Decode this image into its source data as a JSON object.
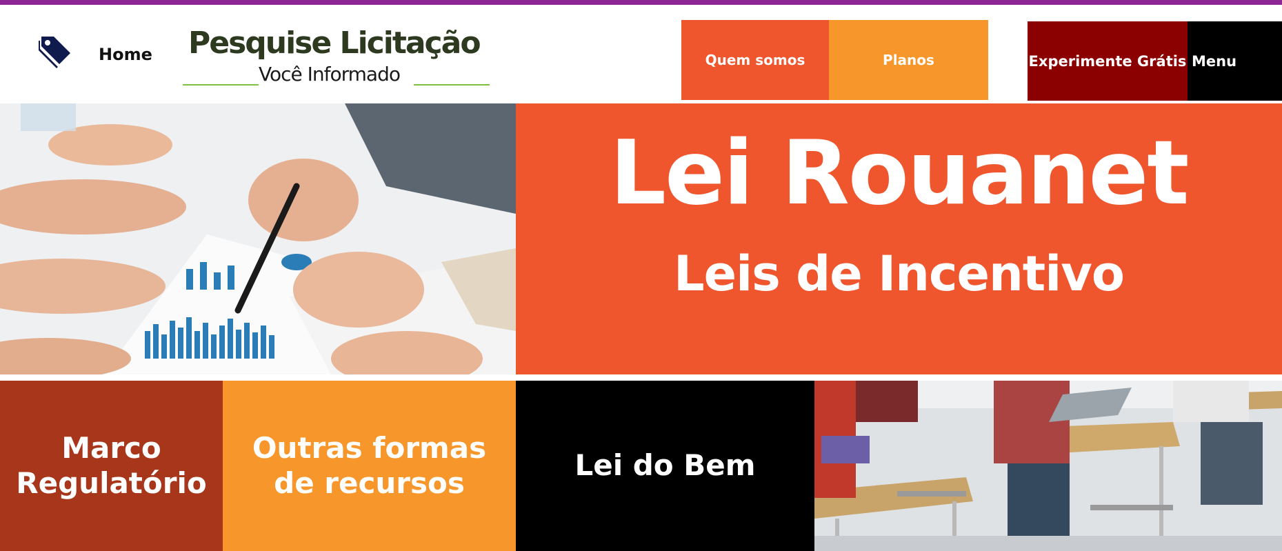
{
  "header": {
    "home_label": "Home",
    "logo_title": "Pesquise Licitação",
    "logo_subtitle": "Você Informado",
    "nav": {
      "quem_somos": "Quem somos",
      "planos": "Planos",
      "experimente": "Experimente Grátis",
      "menu": "Menu"
    }
  },
  "hero": {
    "title": "Lei Rouanet",
    "subtitle": "Leis de Incentivo"
  },
  "tiles": {
    "marco_line1": "Marco",
    "marco_line2": "Regulatório",
    "outras_line1": "Outras formas",
    "outras_line2": "de recursos",
    "lei_do_bem": "Lei do Bem"
  },
  "colors": {
    "top_line": "#8e2594",
    "orange": "#f0562d",
    "amber": "#f7962a",
    "dark_red": "#8b0000",
    "rust": "#a8361b",
    "black": "#000000"
  },
  "icons": {
    "home": "tag-icon"
  }
}
